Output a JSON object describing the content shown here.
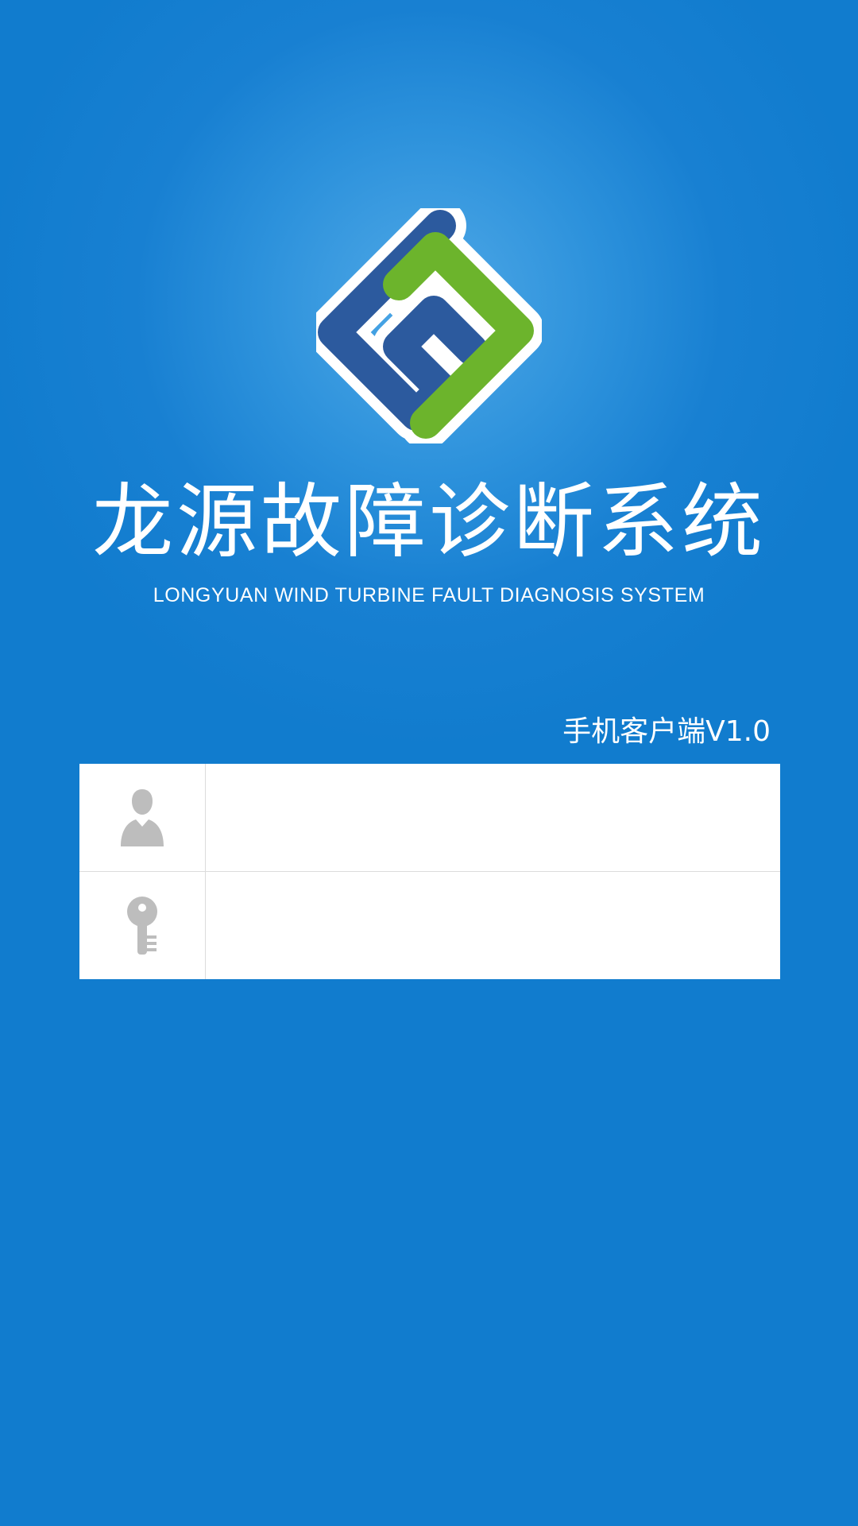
{
  "app": {
    "title": "龙源故障诊断系统",
    "subtitle": "LONGYUAN WIND TURBINE FAULT DIAGNOSIS SYSTEM",
    "version_label": "手机客户端V1.0"
  },
  "login": {
    "username": {
      "value": "",
      "placeholder": "",
      "icon": "user-icon"
    },
    "password": {
      "value": "",
      "placeholder": "",
      "icon": "key-icon"
    }
  },
  "colors": {
    "background": "#117cce",
    "background_glow": "#4fa8e6",
    "logo_blue": "#2c5a9e",
    "logo_green": "#6cb42c",
    "icon_gray": "#bdbdbd",
    "panel": "#ffffff"
  }
}
